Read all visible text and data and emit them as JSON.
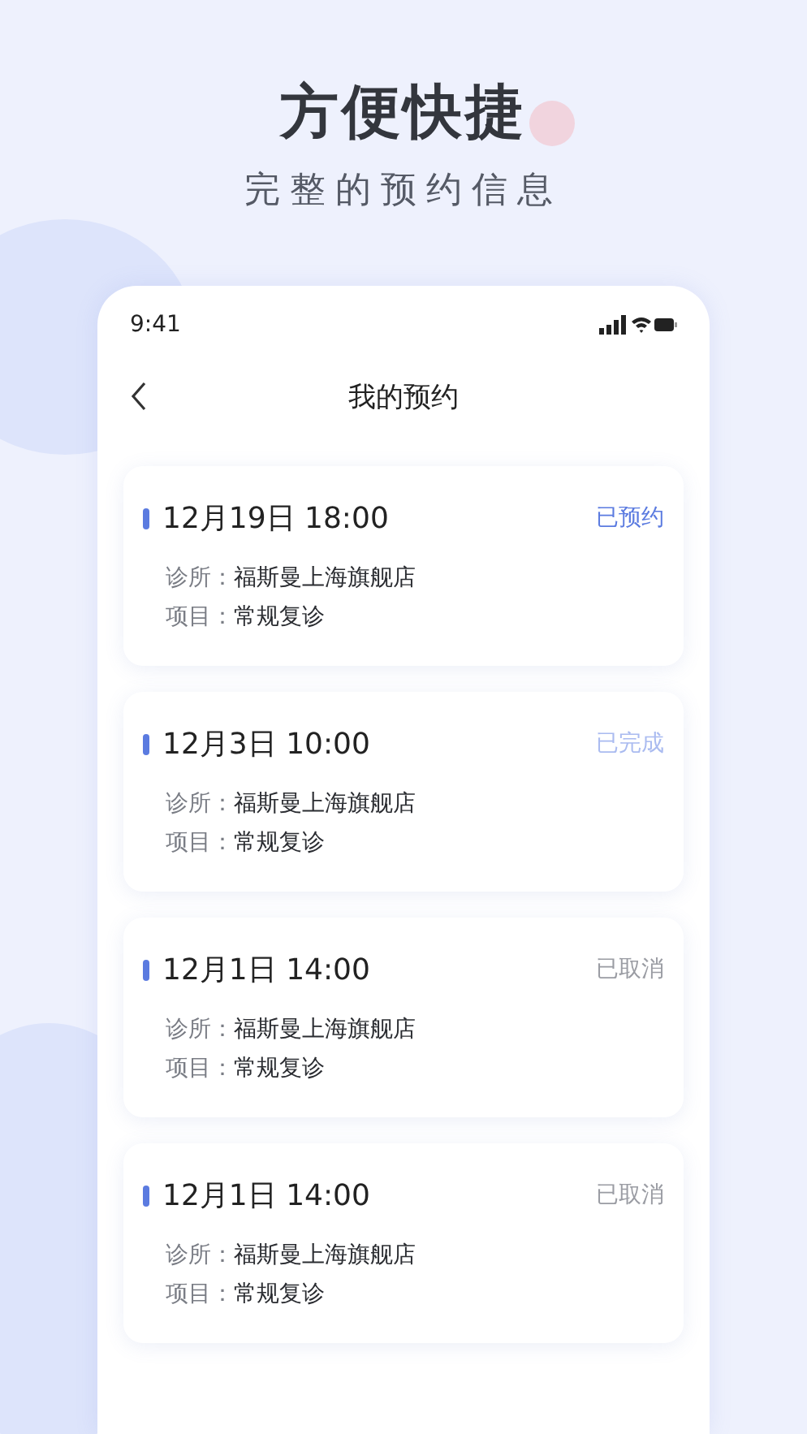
{
  "headline": "方便快捷",
  "subtitle": "完整的预约信息",
  "phone": {
    "status_bar": {
      "time": "9:41"
    },
    "nav": {
      "title": "我的预约"
    },
    "appointments": [
      {
        "datetime": "12月19日 18:00",
        "status": "已预约",
        "kind": "booked",
        "clinic_label": "诊所：",
        "clinic": "福斯曼上海旗舰店",
        "item_label": "项目：",
        "item": "常规复诊"
      },
      {
        "datetime": "12月3日 10:00",
        "status": "已完成",
        "kind": "done",
        "clinic_label": "诊所：",
        "clinic": "福斯曼上海旗舰店",
        "item_label": "项目：",
        "item": "常规复诊"
      },
      {
        "datetime": "12月1日 14:00",
        "status": "已取消",
        "kind": "cancelled",
        "clinic_label": "诊所：",
        "clinic": "福斯曼上海旗舰店",
        "item_label": "项目：",
        "item": "常规复诊"
      },
      {
        "datetime": "12月1日 14:00",
        "status": "已取消",
        "kind": "cancelled",
        "clinic_label": "诊所：",
        "clinic": "福斯曼上海旗舰店",
        "item_label": "项目：",
        "item": "常规复诊"
      }
    ]
  }
}
